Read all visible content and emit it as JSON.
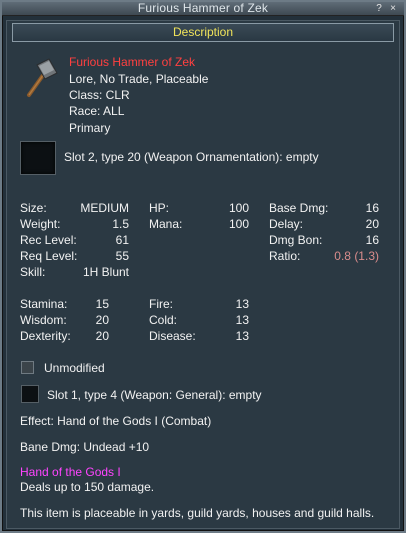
{
  "window": {
    "title": "Furious Hammer of Zek",
    "help_glyph": "?",
    "close_glyph": "×"
  },
  "description_button": "Description",
  "item": {
    "name": "Furious Hammer of Zek",
    "flags": "Lore, No Trade, Placeable",
    "class": "Class: CLR",
    "race": "Race: ALL",
    "slot": "Primary",
    "icon": "hammer-icon"
  },
  "ornament_slot": "Slot 2, type 20 (Weapon Ornamentation): empty",
  "stats_col1": [
    {
      "label": "Size:",
      "value": "MEDIUM"
    },
    {
      "label": "Weight:",
      "value": "1.5"
    },
    {
      "label": "Rec Level:",
      "value": "61"
    },
    {
      "label": "Req Level:",
      "value": "55"
    },
    {
      "label": "Skill:",
      "value": "1H Blunt"
    }
  ],
  "stats_col2": [
    {
      "label": "HP:",
      "value": "100"
    },
    {
      "label": "Mana:",
      "value": "100"
    }
  ],
  "stats_col3": [
    {
      "label": "Base Dmg:",
      "value": "16"
    },
    {
      "label": "Delay:",
      "value": "20"
    },
    {
      "label": "Dmg Bon:",
      "value": "16"
    },
    {
      "label": "Ratio:",
      "value": "0.8 (1.3)"
    }
  ],
  "attrs_col1": [
    {
      "label": "Stamina:",
      "value": "15"
    },
    {
      "label": "Wisdom:",
      "value": "20"
    },
    {
      "label": "Dexterity:",
      "value": "20"
    }
  ],
  "attrs_col2": [
    {
      "label": "Fire:",
      "value": "13"
    },
    {
      "label": "Cold:",
      "value": "13"
    },
    {
      "label": "Disease:",
      "value": "13"
    }
  ],
  "unmodified": "Unmodified",
  "aug_slot": "Slot 1, type 4 (Weapon: General): empty",
  "effect": "Effect: Hand of the Gods I (Combat)",
  "bane": "Bane Dmg: Undead +10",
  "spell": {
    "name": "Hand of the Gods I",
    "desc": "Deals up to 150 damage."
  },
  "placeable_note": "This item is placeable in yards, guild yards, houses and guild halls.",
  "colors": {
    "item_name": "#ff4040",
    "spell_name": "#ff44ff",
    "ratio": "#d98c8c",
    "desc_button_text": "#f0e35a"
  }
}
